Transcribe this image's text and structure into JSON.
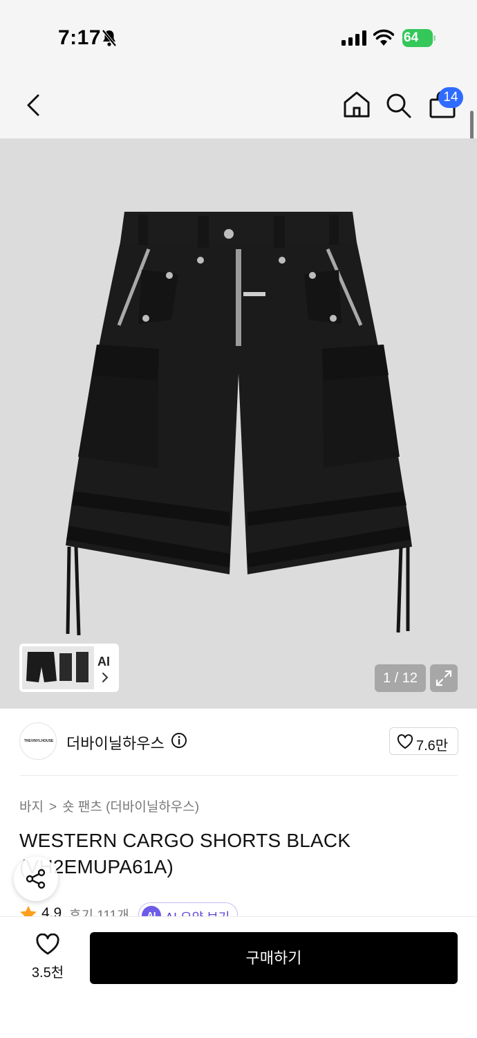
{
  "status_bar": {
    "time": "7:17",
    "battery": "64",
    "icons": [
      "bell-slash-icon",
      "signal-icon",
      "wifi-icon",
      "battery-icon"
    ],
    "colors": {
      "battery": "#34c759"
    }
  },
  "header": {
    "icons": [
      "back-icon",
      "home-icon",
      "search-icon",
      "cart-icon"
    ],
    "cart_badge": "14",
    "colors": {
      "badge": "#2f6bff",
      "background": "#f5f5f5"
    }
  },
  "gallery": {
    "thumbnail_label": "AI",
    "page_counter": "1 / 12",
    "icons": [
      "chevron-right-icon",
      "expand-icon"
    ],
    "colors": {
      "background": "#dcdcdc",
      "product": "#1a1a1a"
    }
  },
  "brand": {
    "logo_text": "THEVINYLHOUSE",
    "name": "더바이닐하우스",
    "likes": "7.6만",
    "icons": [
      "info-icon",
      "heart-icon"
    ]
  },
  "breadcrumb": {
    "items": [
      "바지",
      "숏 팬츠 (더바이닐하우스)"
    ],
    "separator": ">"
  },
  "product": {
    "title": "WESTERN CARGO SHORTS BLACK (VH2EMUPA61A)"
  },
  "rating": {
    "score": "4.9",
    "reviews": "후기 111개",
    "ai_badge": "AI",
    "ai_summary": "AI 요약 보기",
    "colors": {
      "star": "#ff9f1a",
      "ai": "#6c5ce7"
    }
  },
  "bottom_bar": {
    "like_count": "3.5천",
    "buy_label": "구매하기",
    "icons": [
      "heart-icon",
      "share-icon"
    ]
  }
}
